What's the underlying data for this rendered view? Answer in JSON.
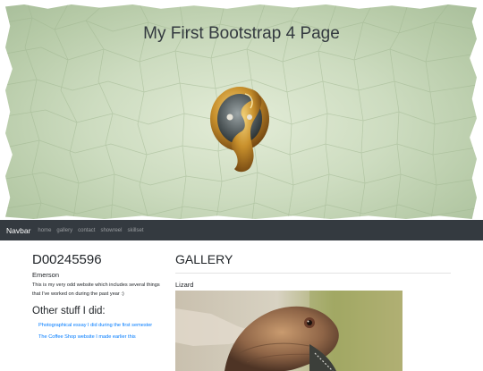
{
  "header": {
    "title": "My First Bootstrap 4 Page"
  },
  "navbar": {
    "brand": "Navbar",
    "links": [
      "home",
      "gallery",
      "contact",
      "showreel",
      "skillset"
    ]
  },
  "profile": {
    "id": "D00245596",
    "name": "Emerson",
    "intro": "This is my very odd website which includes several things that I've worked on during the past year :)",
    "other_title": "Other stuff I did:",
    "links": [
      "Photographical essay I did during the first semester",
      "The Coffee Shop website I made earlier this"
    ]
  },
  "gallery": {
    "title": "GALLERY",
    "items": [
      {
        "caption": "Lizard"
      }
    ]
  },
  "colors": {
    "navbar_bg": "#343a40",
    "link": "#007bff",
    "hero_green": "#b6caa7"
  }
}
